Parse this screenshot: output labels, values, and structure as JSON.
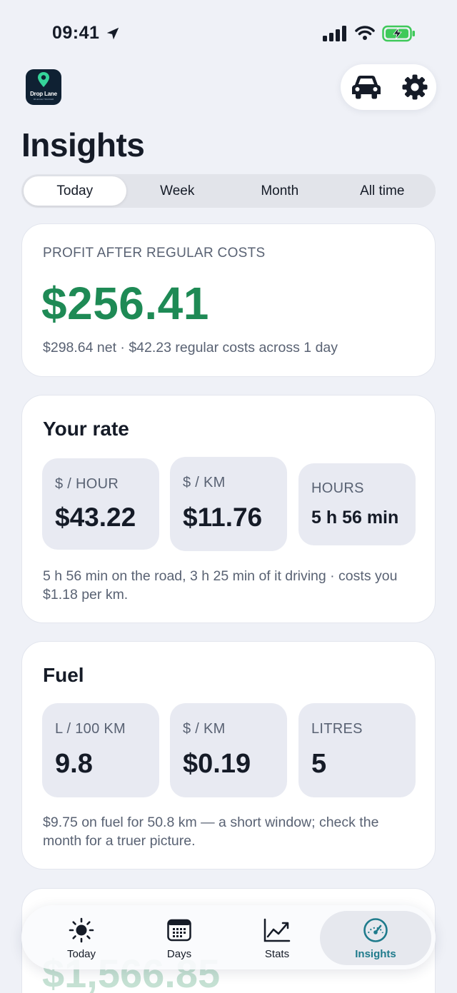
{
  "status_bar": {
    "time": "09:41"
  },
  "app": {
    "logo_text": "Drop Lane",
    "logo_subtext": "MILEAGE TRACKER"
  },
  "page": {
    "title": "Insights"
  },
  "segments": [
    {
      "label": "Today",
      "active": true
    },
    {
      "label": "Week",
      "active": false
    },
    {
      "label": "Month",
      "active": false
    },
    {
      "label": "All time",
      "active": false
    }
  ],
  "profit_card": {
    "label": "PROFIT AFTER REGULAR COSTS",
    "value": "$256.41",
    "subtitle": "$298.64 net · $42.23 regular costs across 1 day",
    "accent_color": "#1e8a55"
  },
  "rate_card": {
    "title": "Your rate",
    "tiles": [
      {
        "label": "$ / HOUR",
        "value": "$43.22"
      },
      {
        "label": "$ / KM",
        "value": "$11.76"
      },
      {
        "label": "HOURS",
        "value": "5 h 56 min"
      }
    ],
    "note": "5 h 56 min on the road, 3 h 25 min of it driving · costs you $1.18 per km."
  },
  "fuel_card": {
    "title": "Fuel",
    "tiles": [
      {
        "label": "L / 100 KM",
        "value": "9.8"
      },
      {
        "label": "$ / KM",
        "value": "$0.19"
      },
      {
        "label": "LITRES",
        "value": "5"
      }
    ],
    "note": "$9.75 on fuel for 50.8 km — a short window; check the month for a truer picture."
  },
  "peek_card": {
    "value": "$1,566.85"
  },
  "tab_bar": {
    "tabs": [
      {
        "label": "Today",
        "icon": "sun-icon"
      },
      {
        "label": "Days",
        "icon": "calendar-icon"
      },
      {
        "label": "Stats",
        "icon": "chart-line-icon"
      },
      {
        "label": "Insights",
        "icon": "gauge-icon",
        "active": true
      }
    ],
    "active_color": "#1f7b8c"
  }
}
